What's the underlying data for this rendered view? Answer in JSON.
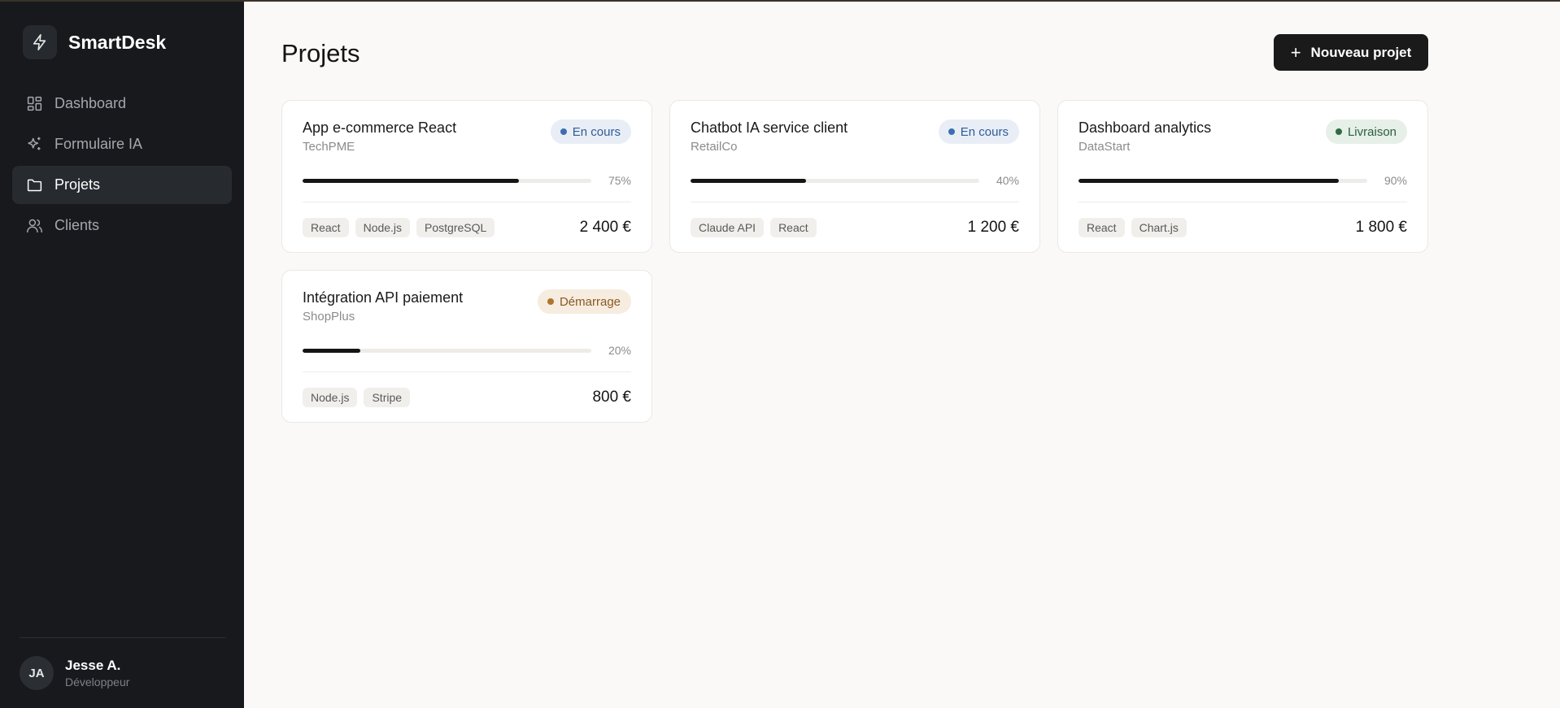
{
  "app": {
    "name": "SmartDesk"
  },
  "sidebar": {
    "items": [
      {
        "label": "Dashboard",
        "icon": "grid-icon"
      },
      {
        "label": "Formulaire IA",
        "icon": "sparkles-icon"
      },
      {
        "label": "Projets",
        "icon": "folder-icon",
        "active": true
      },
      {
        "label": "Clients",
        "icon": "users-icon"
      }
    ],
    "user": {
      "initials": "JA",
      "name": "Jesse A.",
      "role": "Développeur"
    }
  },
  "main": {
    "title": "Projets",
    "new_button_label": "Nouveau projet",
    "projects": [
      {
        "title": "App e-commerce React",
        "client": "TechPME",
        "status": "En cours",
        "status_color": "blue",
        "progress": 75,
        "progress_label": "75%",
        "tags": [
          "React",
          "Node.js",
          "PostgreSQL"
        ],
        "amount": "2 400 €"
      },
      {
        "title": "Chatbot IA service client",
        "client": "RetailCo",
        "status": "En cours",
        "status_color": "blue",
        "progress": 40,
        "progress_label": "40%",
        "tags": [
          "Claude API",
          "React"
        ],
        "amount": "1 200 €"
      },
      {
        "title": "Dashboard analytics",
        "client": "DataStart",
        "status": "Livraison",
        "status_color": "green",
        "progress": 90,
        "progress_label": "90%",
        "tags": [
          "React",
          "Chart.js"
        ],
        "amount": "1 800 €"
      },
      {
        "title": "Intégration API paiement",
        "client": "ShopPlus",
        "status": "Démarrage",
        "status_color": "orange",
        "progress": 20,
        "progress_label": "20%",
        "tags": [
          "Node.js",
          "Stripe"
        ],
        "amount": "800 €"
      }
    ]
  },
  "colors": {
    "sidebar_bg": "#17191d",
    "page_bg": "#faf9f7",
    "primary_button": "#1a1a1a"
  }
}
